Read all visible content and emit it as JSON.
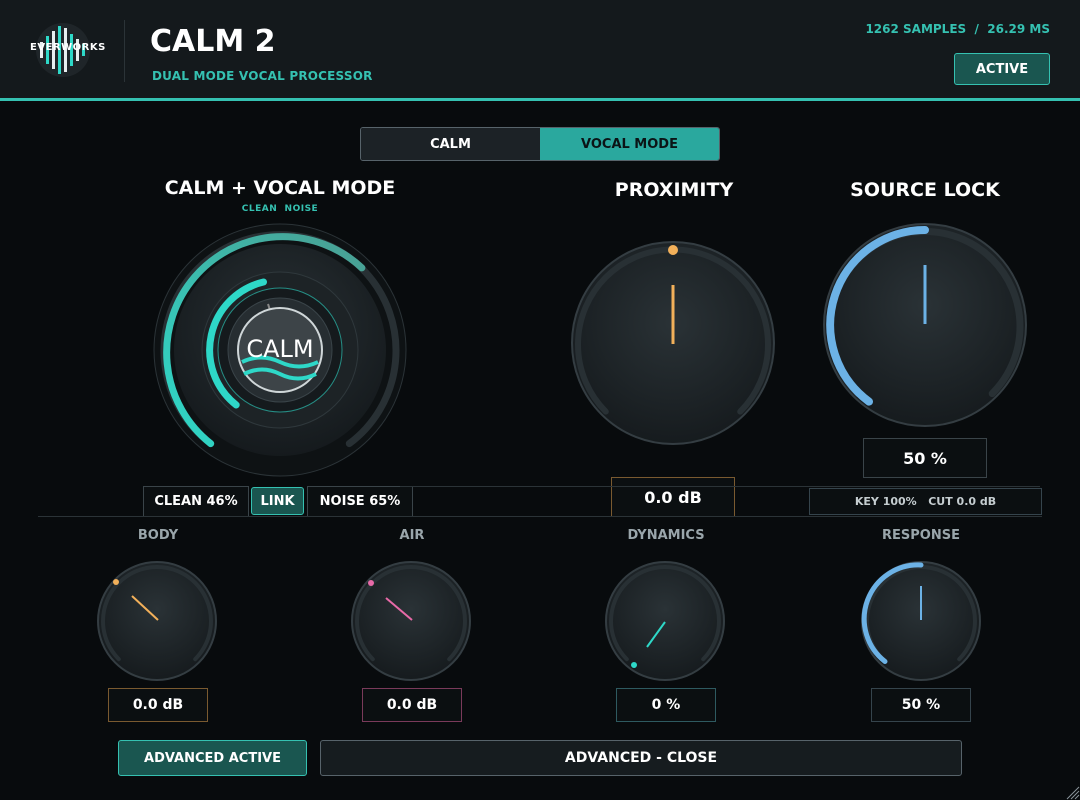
{
  "header": {
    "logo_text": "EVERWORKS",
    "title": "CALM 2",
    "subtitle": "DUAL MODE VOCAL PROCESSOR",
    "latency_samples": "1262 SAMPLES",
    "latency_separator": "/",
    "latency_ms": "26.29 MS",
    "active_label": "ACTIVE"
  },
  "mode_tabs": [
    {
      "label": "CALM",
      "selected": false
    },
    {
      "label": "VOCAL MODE",
      "selected": true
    }
  ],
  "calm_section": {
    "title": "CALM + VOCAL MODE",
    "sub_clean": "CLEAN",
    "sub_noise": "NOISE",
    "center_label": "CALM",
    "clean_value": "CLEAN 46%",
    "link_label": "LINK",
    "noise_value": "NOISE 65%",
    "clean_percent": 46,
    "noise_percent": 65
  },
  "proximity": {
    "title": "PROXIMITY",
    "value": "0.0 dB",
    "accent_color": "#f2b05a"
  },
  "source_lock": {
    "title": "SOURCE LOCK",
    "value": "50 %",
    "key_label": "KEY 100%",
    "cut_label": "CUT 0.0 dB",
    "accent_color": "#6cb2e6"
  },
  "small_knobs": [
    {
      "label": "BODY",
      "value": "0.0 dB",
      "accent_color": "#f2b05a"
    },
    {
      "label": "AIR",
      "value": "0.0 dB",
      "accent_color": "#e86aa8"
    },
    {
      "label": "DYNAMICS",
      "value": "0 %",
      "accent_color": "#2ed8c8"
    },
    {
      "label": "RESPONSE",
      "value": "50 %",
      "accent_color": "#6cb2e6"
    }
  ],
  "footer": {
    "advanced_active_label": "ADVANCED ACTIVE",
    "advanced_close_label": "ADVANCED - CLOSE"
  },
  "colors": {
    "accent": "#35c1b1",
    "background": "#080b0d",
    "header_bg": "#14191c"
  }
}
